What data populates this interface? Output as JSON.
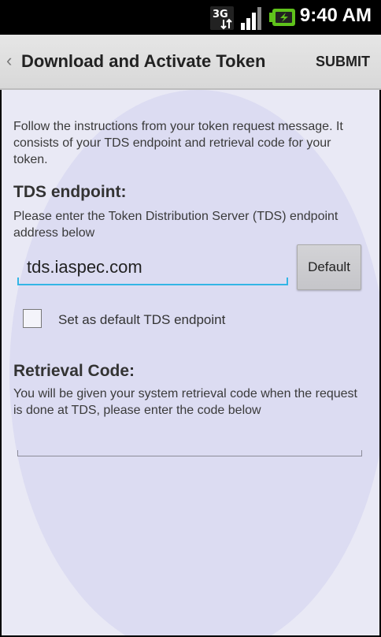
{
  "status_bar": {
    "network_type": "3G",
    "network_icon": "3g-data-icon",
    "signal_icon": "signal-strength-icon",
    "battery_icon": "battery-charging-icon",
    "time": "9:40 AM"
  },
  "action_bar": {
    "back_glyph": "‹",
    "title": "Download and Activate Token",
    "submit_label": "SUBMIT"
  },
  "content": {
    "intro": "Follow the instructions from your token request message. It consists of your TDS endpoint and retrieval code for your token.",
    "tds_label": "TDS endpoint:",
    "tds_description": "Please enter the Token Distribution Server (TDS) endpoint address below",
    "tds_value": "tds.iaspec.com",
    "default_button_label": "Default",
    "checkbox_label": "Set as default TDS endpoint",
    "checkbox_checked": false,
    "retrieval_label": "Retrieval Code:",
    "retrieval_description": "You will be given your system retrieval code when the request is done at TDS, please enter the code below",
    "retrieval_value": ""
  },
  "colors": {
    "accent": "#33b5e5",
    "background": "#e9e9f5",
    "action_bar": "#dedede"
  }
}
